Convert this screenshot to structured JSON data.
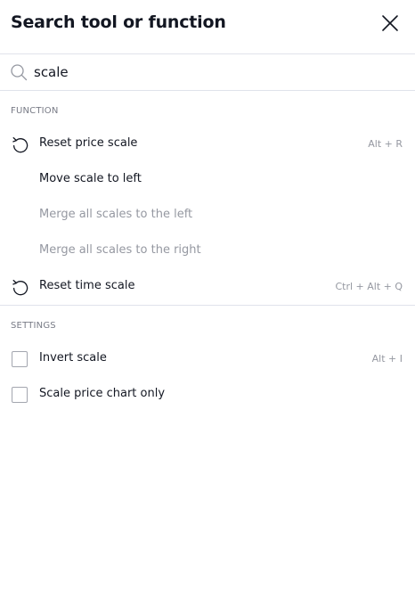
{
  "dialog": {
    "title": "Search tool or function"
  },
  "search": {
    "value": "scale",
    "placeholder": ""
  },
  "sections": {
    "function": {
      "label": "FUNCTION",
      "items": [
        {
          "label": "Reset price scale",
          "shortcut": "Alt + R",
          "icon": "reset-icon",
          "enabled": true
        },
        {
          "label": "Move scale to left",
          "shortcut": "",
          "icon": "",
          "enabled": true
        },
        {
          "label": "Merge all scales to the left",
          "shortcut": "",
          "icon": "",
          "enabled": false
        },
        {
          "label": "Merge all scales to the right",
          "shortcut": "",
          "icon": "",
          "enabled": false
        },
        {
          "label": "Reset time scale",
          "shortcut": "Ctrl + Alt + Q",
          "icon": "reset-icon",
          "enabled": true
        }
      ]
    },
    "settings": {
      "label": "SETTINGS",
      "items": [
        {
          "label": "Invert scale",
          "shortcut": "Alt + I",
          "checked": false
        },
        {
          "label": "Scale price chart only",
          "shortcut": "",
          "checked": false
        }
      ]
    }
  },
  "colors": {
    "text": "#131722",
    "muted": "#787b86",
    "disabled": "#9598a1",
    "divider": "#e0e3eb"
  }
}
